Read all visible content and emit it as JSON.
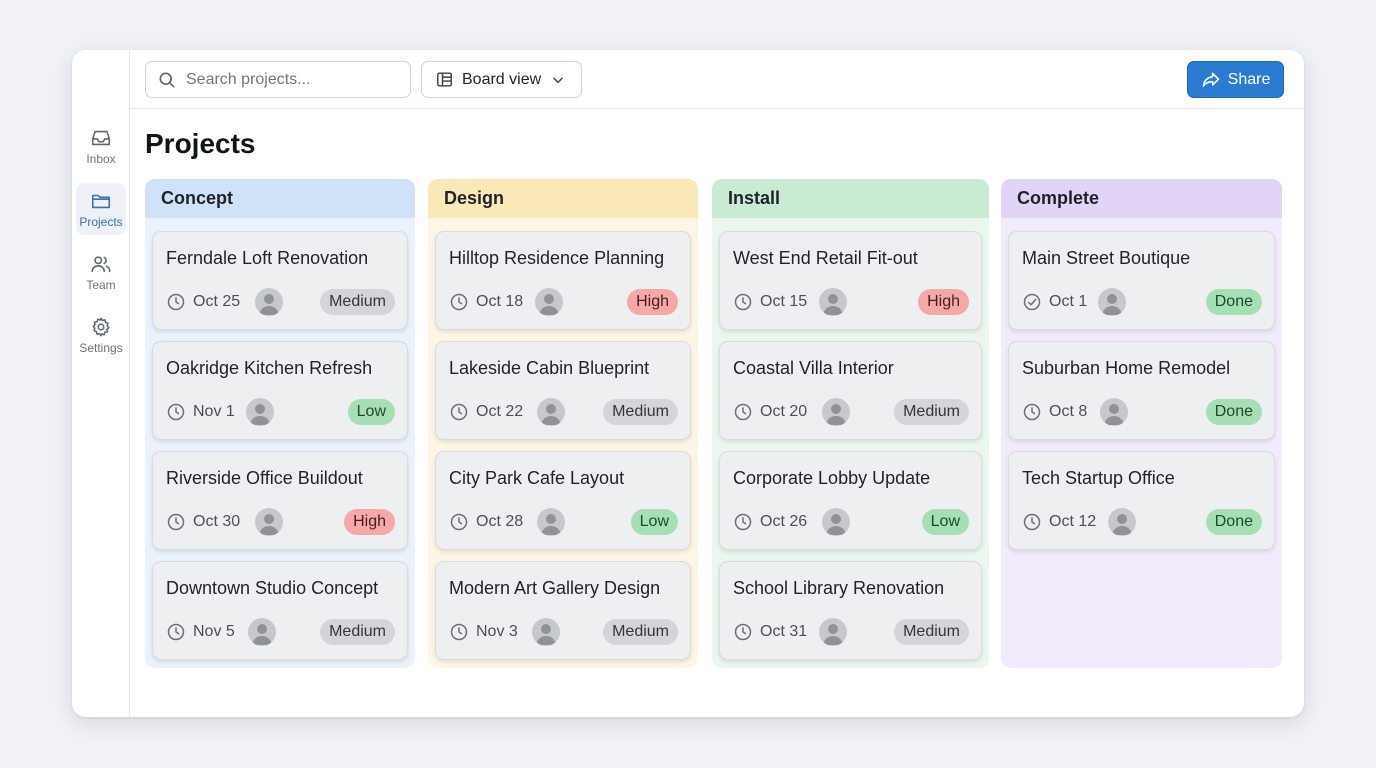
{
  "sidebar": {
    "items": [
      {
        "label": "Inbox",
        "icon": "inbox-icon",
        "active": false
      },
      {
        "label": "Projects",
        "icon": "folder-icon",
        "active": true
      },
      {
        "label": "Team",
        "icon": "users-icon",
        "active": false
      },
      {
        "label": "Settings",
        "icon": "gear-icon",
        "active": false
      }
    ]
  },
  "toolbar": {
    "search_placeholder": "Search projects...",
    "view_label": "Board view",
    "share_label": "Share"
  },
  "page": {
    "title": "Projects"
  },
  "colors": {
    "accent": "#2b7bd3",
    "concept": "#cfe2f8",
    "design": "#fbe8b8",
    "install": "#c9ead3",
    "complete": "#e2d4f6"
  },
  "columns": [
    {
      "name": "Concept",
      "cards": [
        {
          "title": "Ferndale Loft Renovation",
          "date": "Oct 25",
          "status": "Medium",
          "icon": "clock-icon"
        },
        {
          "title": "Oakridge Kitchen Refresh",
          "date": "Nov 1",
          "status": "Low",
          "icon": "clock-icon"
        },
        {
          "title": "Riverside Office Buildout",
          "date": "Oct 30",
          "status": "High",
          "icon": "clock-icon"
        },
        {
          "title": "Downtown Studio Concept",
          "date": "Nov 5",
          "status": "Medium",
          "icon": "clock-icon"
        }
      ]
    },
    {
      "name": "Design",
      "cards": [
        {
          "title": "Hilltop Residence Planning",
          "date": "Oct 18",
          "status": "High",
          "icon": "clock-icon"
        },
        {
          "title": "Lakeside Cabin Blueprint",
          "date": "Oct 22",
          "status": "Medium",
          "icon": "clock-icon"
        },
        {
          "title": "City Park Cafe Layout",
          "date": "Oct 28",
          "status": "Low",
          "icon": "clock-icon"
        },
        {
          "title": "Modern Art Gallery Design",
          "date": "Nov 3",
          "status": "Medium",
          "icon": "clock-icon"
        }
      ]
    },
    {
      "name": "Install",
      "cards": [
        {
          "title": "West End Retail Fit-out",
          "date": "Oct 15",
          "status": "High",
          "icon": "clock-icon"
        },
        {
          "title": "Coastal Villa Interior",
          "date": "Oct 20",
          "status": "Medium",
          "icon": "clock-icon"
        },
        {
          "title": "Corporate Lobby Update",
          "date": "Oct 26",
          "status": "Low",
          "icon": "clock-icon"
        },
        {
          "title": "School Library Renovation",
          "date": "Oct 31",
          "status": "Medium",
          "icon": "clock-icon"
        }
      ]
    },
    {
      "name": "Complete",
      "cards": [
        {
          "title": "Main Street Boutique",
          "date": "Oct 1",
          "status": "Done",
          "icon": "check-circle-icon"
        },
        {
          "title": "Suburban Home Remodel",
          "date": "Oct 8",
          "status": "Done",
          "icon": "clock-icon"
        },
        {
          "title": "Tech Startup Office",
          "date": "Oct 12",
          "status": "Done",
          "icon": "clock-icon"
        }
      ]
    }
  ]
}
